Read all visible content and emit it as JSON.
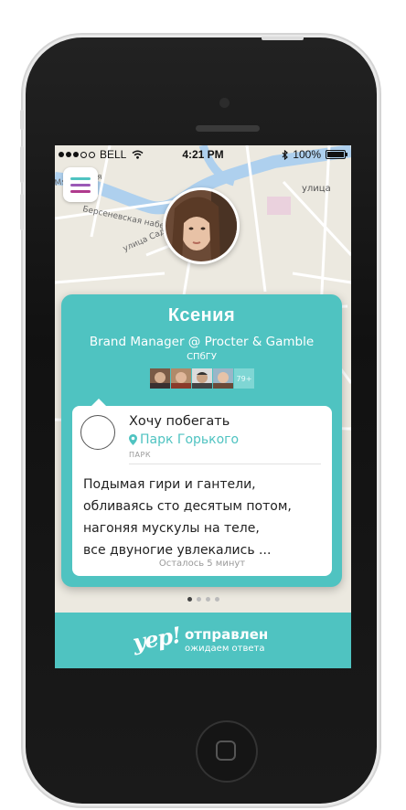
{
  "status_bar": {
    "carrier": "BELL",
    "time": "4:21 PM",
    "battery": "100%"
  },
  "map": {
    "street_labels": [
      "Мясницкая",
      "Берсеневская набережная",
      "улица Садовническая",
      "улица"
    ]
  },
  "profile": {
    "name": "Ксения",
    "job": "Brand Manager @ Procter & Gamble",
    "university": "СПбГУ",
    "mutual_more": "79+"
  },
  "activity": {
    "title": "Хочу побегать",
    "place": "Парк Горького",
    "place_type": "ПАРК",
    "message_lines": [
      "Подымая гири и гантели,",
      "обливаясь сто десятым потом,",
      "нагоняя мускулы на теле,",
      "все двуногие увлекались ..."
    ],
    "time_left": "Осталось 5 минут"
  },
  "pager": {
    "count": 4,
    "active": 0
  },
  "footer": {
    "logo": "yep!",
    "status": "отправлен",
    "substatus": "ожидаем ответа"
  },
  "colors": {
    "accent": "#4fc3c1",
    "menu_lines": [
      "#4fc3c1",
      "#9b59b6",
      "#b03a8e"
    ]
  }
}
